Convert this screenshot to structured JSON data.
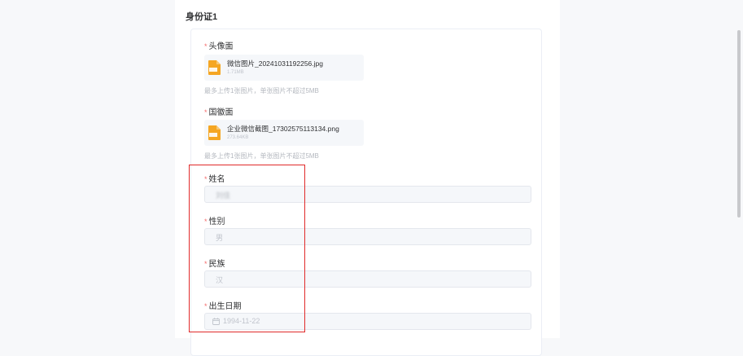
{
  "section": {
    "title": "身份证1"
  },
  "fields": {
    "front": {
      "required": "*",
      "label": "头像面"
    },
    "back": {
      "required": "*",
      "label": "国徽面"
    },
    "name": {
      "required": "*",
      "label": "姓名",
      "value": "刘佳"
    },
    "gender": {
      "required": "*",
      "label": "性别",
      "value": "男"
    },
    "ethnicity": {
      "required": "*",
      "label": "民族",
      "value": "汉"
    },
    "birthdate": {
      "required": "*",
      "label": "出生日期",
      "value": "1994-11-22",
      "icon": "calendar-icon"
    }
  },
  "files": {
    "front": {
      "name": "微信图片_20241031192256.jpg",
      "size": "1.71MB",
      "type": "JPG",
      "icon": "image-file-icon"
    },
    "back": {
      "name": "企业微信截图_17302575113134.png",
      "size": "273.64KB",
      "type": "PNG",
      "icon": "image-file-icon"
    }
  },
  "upload_tip": "最多上传1张图片，单张图片不超过5MB",
  "colors": {
    "required": "#f56c6c",
    "file_icon": "#f5a623",
    "highlight_border": "#e02a2a"
  }
}
